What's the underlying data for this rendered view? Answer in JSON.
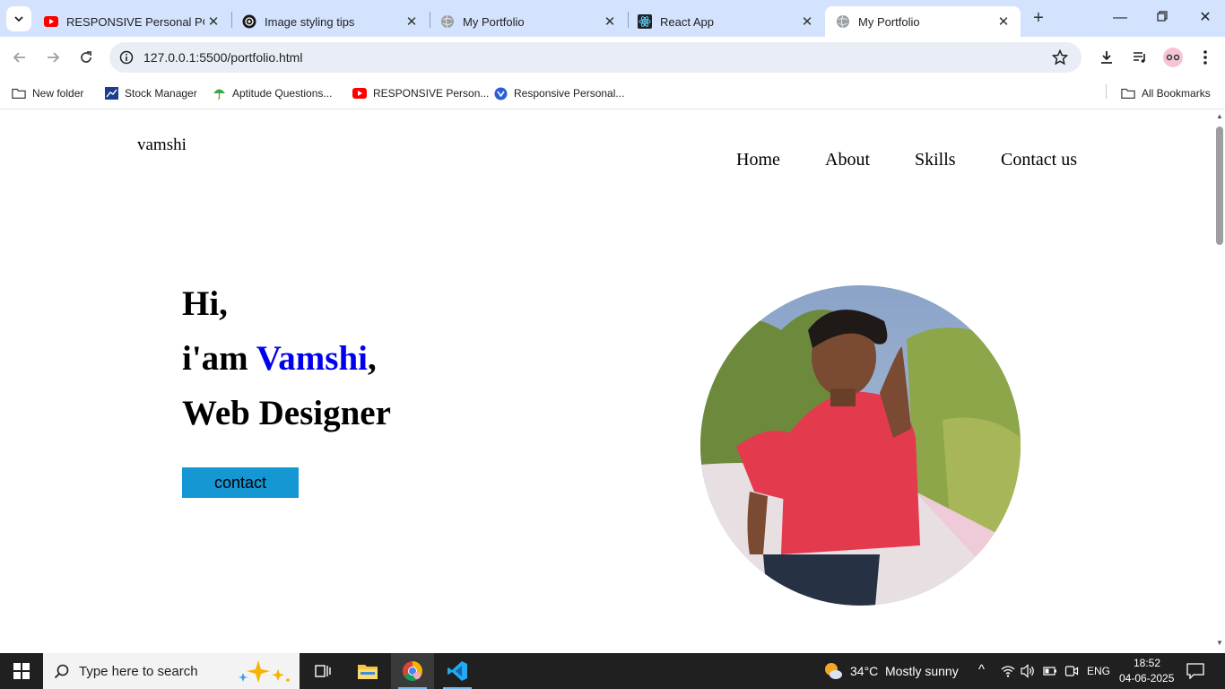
{
  "browser": {
    "tabs": [
      {
        "title": "RESPONSIVE Personal PORTFOLIO",
        "favicon": "youtube-icon"
      },
      {
        "title": "Image styling tips",
        "favicon": "chatgpt-icon"
      },
      {
        "title": "My Portfolio",
        "favicon": "globe-icon"
      },
      {
        "title": "React App",
        "favicon": "react-icon"
      },
      {
        "title": "My Portfolio",
        "favicon": "globe-icon",
        "active": true
      }
    ],
    "url": "127.0.0.1:5500/portfolio.html",
    "bookmarks": [
      {
        "label": "New folder",
        "icon": "folder-icon"
      },
      {
        "label": "Stock Manager",
        "icon": "chart-icon"
      },
      {
        "label": "Aptitude Questions...",
        "icon": "umbrella-icon"
      },
      {
        "label": "RESPONSIVE Person...",
        "icon": "youtube-icon"
      },
      {
        "label": "Responsive Personal...",
        "icon": "blue-circle-icon"
      }
    ],
    "all_bookmarks": "All Bookmarks"
  },
  "page": {
    "logo": "vamshi",
    "nav": [
      "Home",
      "About",
      "Skills",
      "Contact us"
    ],
    "hero": {
      "greeting": "Hi,",
      "intro_prefix": "i'am ",
      "name": "Vamshi",
      "intro_suffix": ",",
      "role": "Web Designer",
      "button": "contact"
    },
    "colors": {
      "name": "#0000ee",
      "button": "#1497d3"
    }
  },
  "taskbar": {
    "search_placeholder": "Type here to search",
    "weather": {
      "temp": "34°C",
      "condition": "Mostly sunny"
    },
    "language": "ENG",
    "time": "18:52",
    "date": "04-06-2025"
  }
}
